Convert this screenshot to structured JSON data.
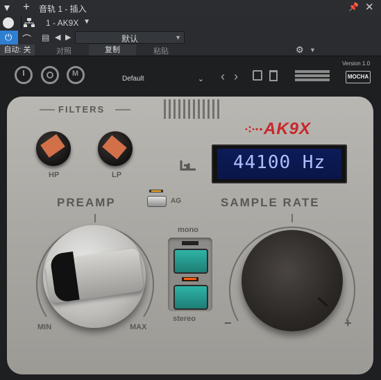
{
  "host": {
    "title": "音轨 1 - 插入",
    "preset_slot": "1 - AK9X",
    "preset_name": "默认",
    "auto_label": "自动: 关",
    "compare_label": "对照",
    "copy_label": "复制",
    "paste_label": "粘贴",
    "icons": [
      "plus-icon",
      "pin-icon",
      "close-icon",
      "power-icon",
      "routing-icon",
      "arrow-left-icon",
      "arrow-right-icon",
      "gear-icon",
      "chevron-down-icon"
    ]
  },
  "plugin": {
    "version": "Version 1.0",
    "brand_button": "MOCHA",
    "preset": "Default",
    "logo": "AK9X",
    "filters_label": "FILTERS",
    "hp_label": "HP",
    "lp_label": "LP",
    "display": "44100 Hz",
    "preamp_label": "PREAMP",
    "ag_label": "AG",
    "sample_rate_label": "SAMPLE RATE",
    "mono_label": "mono",
    "stereo_label": "stereo",
    "min_label": "MIN",
    "max_label": "MAX",
    "minus_label": "−",
    "plus_label": "+",
    "accent": "#c8262b",
    "button_color": "#2aa59a"
  }
}
